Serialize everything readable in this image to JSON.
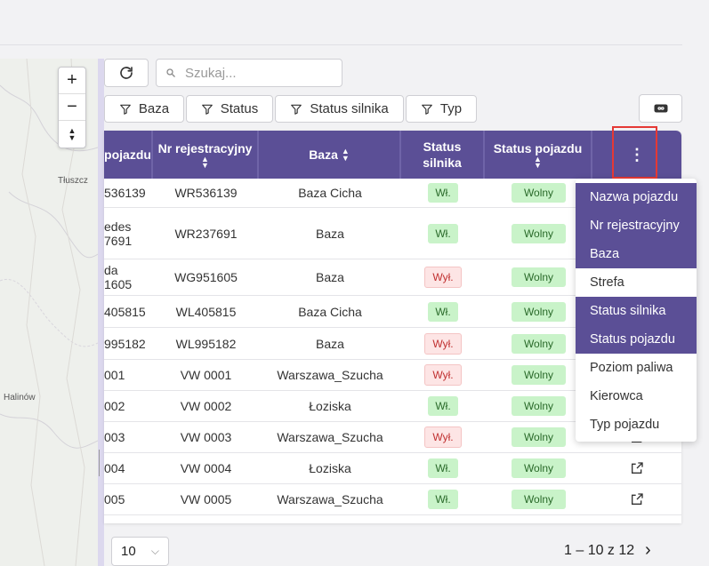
{
  "map": {
    "labels": [
      "Tłuszcz",
      "Halinów"
    ],
    "zoom_in": "+",
    "zoom_out": "−",
    "compass": "▲▼"
  },
  "toolbar": {
    "refresh_icon": "refresh-icon",
    "search_placeholder": "Szukaj...",
    "filters": [
      "Baza",
      "Status",
      "Status silnika",
      "Typ"
    ],
    "link_icon": "infinity-link-icon"
  },
  "table": {
    "columns": [
      {
        "label": "pojazdu"
      },
      {
        "label": "Nr rejestracyjny"
      },
      {
        "label": "Baza"
      },
      {
        "label": "Status silnika"
      },
      {
        "label": "Status pojazdu"
      },
      {
        "label": "⋮"
      }
    ],
    "rows": [
      {
        "vehicle": "536139",
        "reg": "WR536139",
        "base": "Baza Cicha",
        "engine": "Wł.",
        "status": "Wolny"
      },
      {
        "vehicle": "edes 7691",
        "reg": "WR237691",
        "base": "Baza",
        "engine": "Wł.",
        "status": "Wolny"
      },
      {
        "vehicle": "da 1605",
        "reg": "WG951605",
        "base": "Baza",
        "engine": "Wył.",
        "status": "Wolny"
      },
      {
        "vehicle": "405815",
        "reg": "WL405815",
        "base": "Baza Cicha",
        "engine": "Wł.",
        "status": "Wolny"
      },
      {
        "vehicle": "995182",
        "reg": "WL995182",
        "base": "Baza",
        "engine": "Wył.",
        "status": "Wolny"
      },
      {
        "vehicle": "001",
        "reg": "VW 0001",
        "base": "Warszawa_Szucha",
        "engine": "Wył.",
        "status": "Wolny"
      },
      {
        "vehicle": "002",
        "reg": "VW 0002",
        "base": "Łoziska",
        "engine": "Wł.",
        "status": "Wolny"
      },
      {
        "vehicle": "003",
        "reg": "VW 0003",
        "base": "Warszawa_Szucha",
        "engine": "Wył.",
        "status": "Wolny"
      },
      {
        "vehicle": "004",
        "reg": "VW 0004",
        "base": "Łoziska",
        "engine": "Wł.",
        "status": "Wolny"
      },
      {
        "vehicle": "005",
        "reg": "VW 0005",
        "base": "Warszawa_Szucha",
        "engine": "Wł.",
        "status": "Wolny"
      }
    ]
  },
  "column_menu": {
    "items": [
      {
        "label": "Nazwa pojazdu",
        "selected": true
      },
      {
        "label": "Nr rejestracyjny",
        "selected": true
      },
      {
        "label": "Baza",
        "selected": true
      },
      {
        "label": "Strefa",
        "selected": false
      },
      {
        "label": "Status silnika",
        "selected": true
      },
      {
        "label": "Status pojazdu",
        "selected": true
      },
      {
        "label": "Poziom paliwa",
        "selected": false
      },
      {
        "label": "Kierowca",
        "selected": false
      },
      {
        "label": "Typ pojazdu",
        "selected": false
      }
    ]
  },
  "footer": {
    "page_size": "10",
    "range": "1 – 10 z 12",
    "next": "›"
  },
  "colors": {
    "header": "#5b4f96",
    "on_badge": "#c9f3c9",
    "off_badge": "#fde5e5"
  }
}
